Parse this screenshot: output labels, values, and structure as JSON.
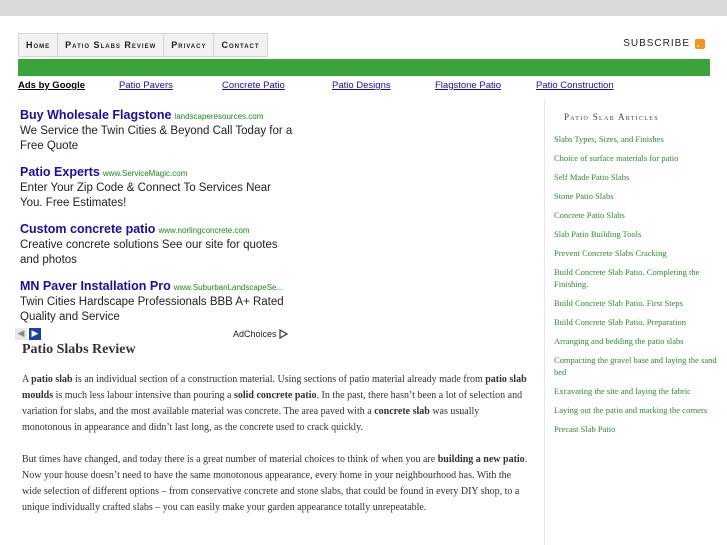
{
  "nav": {
    "items": [
      "Home",
      "Patio Slabs Review",
      "Privacy",
      "Contact"
    ],
    "subscribe_label": "SUBSCRIBE"
  },
  "ad_links": {
    "ads_by_label": "Ads by Google",
    "links": [
      "Patio Pavers",
      "Concrete Patio",
      "Patio Designs",
      "Flagstone Patio",
      "Patio Construction"
    ]
  },
  "ads": [
    {
      "title": "Buy Wholesale Flagstone",
      "url": "landscaperesources.com",
      "desc": "We Service the Twin Cities & Beyond Call Today for a Free Quote"
    },
    {
      "title": "Patio Experts",
      "url": "www.ServiceMagic.com",
      "desc": "Enter Your Zip Code & Connect To Services Near You. Free Estimates!"
    },
    {
      "title": "Custom concrete patio",
      "url": "www.norlingconcrete.com",
      "desc": "Creative concrete solutions See our site for quotes and photos"
    },
    {
      "title": "MN Paver Installation Pro",
      "url": "www.SuburbanLandscapeSe...",
      "desc": "Twin Cities Hardscape Professionals BBB A+ Rated Quality and Service"
    }
  ],
  "ad_choices_label": "AdChoices",
  "main": {
    "title": "Patio Slabs Review",
    "p1": {
      "t1": "A ",
      "b1": "patio slab",
      "t2": " is an individual section of a construction material.  Using sections of patio material already made from ",
      "b2": "patio slab moulds",
      "t3": " is much less labour intensive than pouring a ",
      "b3": "solid concrete patio",
      "t4": ". In the past, there hasn’t been a lot of selection and variation for slabs, and the most available material was concrete. The area paved with a ",
      "b4": "concrete slab",
      "t5": " was usually monotonous in appearance and didn’t last long, as the concrete used to crack quickly."
    },
    "p2": {
      "t1": "But times have changed, and today there is a great number of material choices to think of when you are ",
      "b1": "building a new patio",
      "t2": ". Now your house doesn’t need to have the same monotonous appearance,  every home in your neighbourhood has. With the wide selection of different options – from conservative concrete and stone slabs, that could be found in every DIY shop, to a unique individually crafted slabs – you can easily make your garden appearance totally unrepeatable."
    }
  },
  "sidebar": {
    "heading": "Patio Slab Articles",
    "items": [
      "Slabs Types, Sizes, and Finishes",
      "Choice of surface materials for patio",
      "Self Made Patio Slabs",
      "Stone Patio Slabs",
      "Concrete Patio Slabs",
      "Slab Patio Building Tools",
      "Prevent Concrete Slabs Cracking",
      "Build Concrete Slab Patio. Completing the Finishing.",
      "Build Concrete Slab Patio. First Steps",
      "Build Concrete Slab Patio. Preparation",
      "Arranging and bedding the patio slabs",
      "Compacting the gravel base and laying the sand bed",
      "Excavating the site and laying the fabric",
      "Laying out the patio and marking the corners",
      "Precast Slab Patio"
    ]
  },
  "colors": {
    "green_bar": "#3aa43a",
    "link_blue": "#1a0dab",
    "sidebar_link": "#2e8b2e"
  }
}
